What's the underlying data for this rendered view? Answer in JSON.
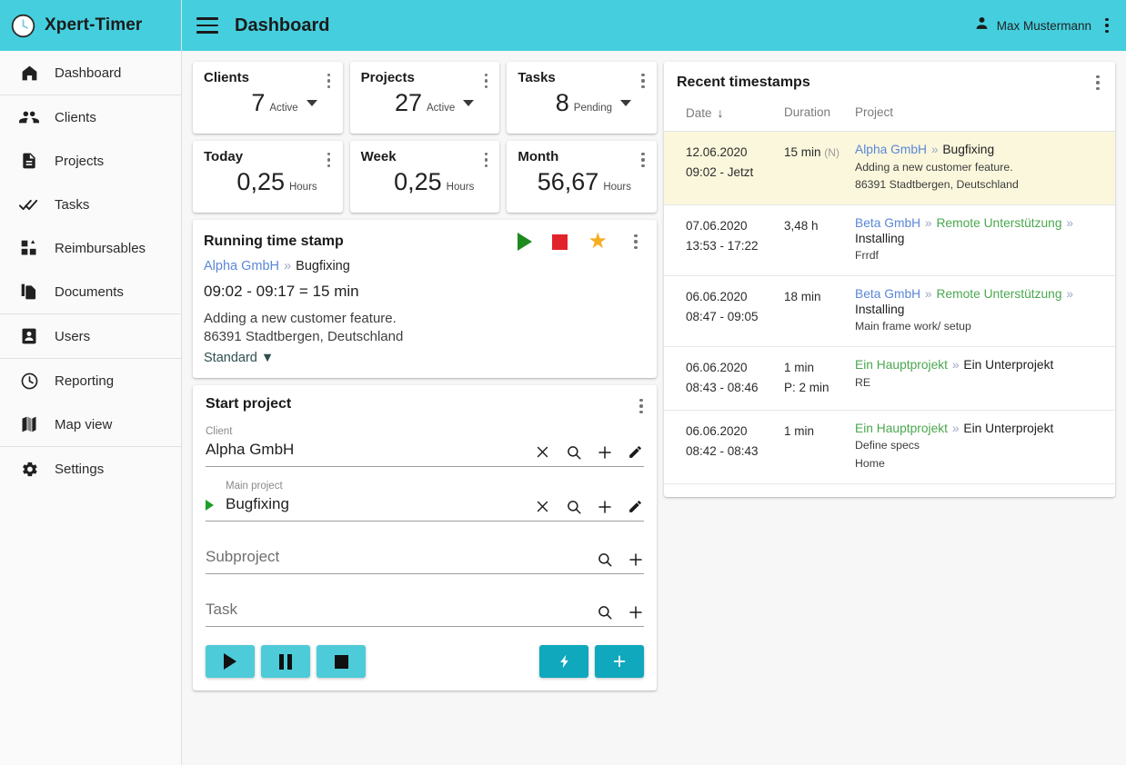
{
  "brand": {
    "title": "Xpert-Timer",
    "logo_icon": "clock-icon"
  },
  "topbar": {
    "menu_icon": "hamburger-icon",
    "title": "Dashboard",
    "user_name": "Max Mustermann",
    "user_icon": "person-icon",
    "overflow_icon": "kebab-menu-icon"
  },
  "colors": {
    "header": "#45cfde",
    "button_light": "#4ecbd9",
    "button_dark": "#0fa8bd",
    "highlight_row": "#fbf7dc",
    "link_blue": "#5a87d8",
    "link_green": "#4aa84f",
    "star": "#f5ad21",
    "stop_red": "#e3232b",
    "play_green": "#1e8a1e"
  },
  "sidebar": {
    "items": [
      {
        "label": "Dashboard",
        "icon": "home-icon"
      },
      {
        "label": "Clients",
        "icon": "people-icon"
      },
      {
        "label": "Projects",
        "icon": "document-icon"
      },
      {
        "label": "Tasks",
        "icon": "double-check-icon"
      },
      {
        "label": "Reimbursables",
        "icon": "dashboard-blocks-icon"
      },
      {
        "label": "Documents",
        "icon": "copy-documents-icon"
      },
      {
        "label": "Users",
        "icon": "user-card-icon"
      },
      {
        "label": "Reporting",
        "icon": "clock-icon"
      },
      {
        "label": "Map view",
        "icon": "map-icon"
      },
      {
        "label": "Settings",
        "icon": "gear-icon"
      }
    ]
  },
  "stats": [
    {
      "title": "Clients",
      "value": "7",
      "unit": "Active",
      "has_caret": true
    },
    {
      "title": "Projects",
      "value": "27",
      "unit": "Active",
      "has_caret": true
    },
    {
      "title": "Tasks",
      "value": "8",
      "unit": "Pending",
      "has_caret": true
    },
    {
      "title": "Today",
      "value": "0,25",
      "unit": "Hours",
      "has_caret": false
    },
    {
      "title": "Week",
      "value": "0,25",
      "unit": "Hours",
      "has_caret": false
    },
    {
      "title": "Month",
      "value": "56,67",
      "unit": "Hours",
      "has_caret": false
    }
  ],
  "running": {
    "title": "Running time stamp",
    "client": "Alpha GmbH",
    "separator": "»",
    "project": "Bugfixing",
    "times": "09:02 -  09:17  = 15 min",
    "description": "Adding a new customer feature.",
    "address": "86391 Stadtbergen, Deutschland",
    "rate": "Standard ▼",
    "actions": [
      "play-icon",
      "stop-icon",
      "star-icon",
      "kebab-menu-icon"
    ]
  },
  "start_project": {
    "title": "Start project",
    "fields": [
      {
        "label": "Client",
        "value": "Alpha GmbH",
        "placeholder": "",
        "icons": [
          "clear-icon",
          "search-icon",
          "add-icon",
          "edit-icon"
        ],
        "indent": false,
        "running": false
      },
      {
        "label": "Main project",
        "value": "Bugfixing",
        "placeholder": "",
        "icons": [
          "clear-icon",
          "search-icon",
          "add-icon",
          "edit-icon"
        ],
        "indent": true,
        "running": true
      },
      {
        "label": "",
        "value": "",
        "placeholder": "Subproject",
        "icons": [
          "search-icon",
          "add-icon"
        ],
        "indent": false,
        "running": false
      },
      {
        "label": "",
        "value": "",
        "placeholder": "Task",
        "icons": [
          "search-icon",
          "add-icon"
        ],
        "indent": false,
        "running": false
      }
    ],
    "buttons": [
      {
        "name": "start-button",
        "icon": "play-icon",
        "style": "light"
      },
      {
        "name": "pause-button",
        "icon": "pause-icon",
        "style": "light"
      },
      {
        "name": "stop-button",
        "icon": "stop-icon",
        "style": "light"
      },
      {
        "name": "quick-add-button",
        "icon": "bolt-icon",
        "style": "dark"
      },
      {
        "name": "add-button",
        "icon": "plus-icon",
        "style": "dark"
      }
    ]
  },
  "recent": {
    "title": "Recent timestamps",
    "columns": {
      "date": "Date",
      "duration": "Duration",
      "project": "Project",
      "sort_icon": "arrow-down-icon"
    },
    "rows": [
      {
        "date": "12.06.2020",
        "time": "09:02 - Jetzt",
        "time_bold": true,
        "duration": "15 min",
        "duration_flag": "(N)",
        "duration_extra": "",
        "client": "Alpha GmbH",
        "client_color": "blue",
        "project": "Bugfixing",
        "mid": "",
        "lines": [
          "Adding a new customer feature.",
          "86391 Stadtbergen, Deutschland"
        ],
        "highlight": true
      },
      {
        "date": "07.06.2020",
        "time": "13:53 - 17:22",
        "time_bold": false,
        "duration": "3,48 h",
        "duration_flag": "",
        "duration_extra": "",
        "client": "Beta GmbH",
        "client_color": "blue",
        "mid": "Remote Unterstützung",
        "project": "Installing",
        "lines": [
          "Frrdf"
        ],
        "highlight": false
      },
      {
        "date": "06.06.2020",
        "time": "08:47 - 09:05",
        "time_bold": false,
        "duration": "18 min",
        "duration_flag": "",
        "duration_extra": "",
        "client": "Beta GmbH",
        "client_color": "blue",
        "mid": "Remote Unterstützung",
        "project": "Installing",
        "lines": [
          "Main frame work/ setup"
        ],
        "highlight": false
      },
      {
        "date": "06.06.2020",
        "time": "08:43 - 08:46",
        "time_bold": false,
        "duration": "1 min",
        "duration_flag": "",
        "duration_extra": "P: 2 min",
        "client": "Ein Hauptprojekt",
        "client_color": "green",
        "mid": "",
        "project": "Ein Unterprojekt",
        "lines": [
          "RE"
        ],
        "highlight": false
      },
      {
        "date": "06.06.2020",
        "time": "08:42 - 08:43",
        "time_bold": false,
        "duration": "1 min",
        "duration_flag": "",
        "duration_extra": "",
        "client": "Ein Hauptprojekt",
        "client_color": "green",
        "mid": "",
        "project": "Ein Unterprojekt",
        "lines": [
          "Define specs",
          "Home"
        ],
        "highlight": false
      }
    ]
  }
}
